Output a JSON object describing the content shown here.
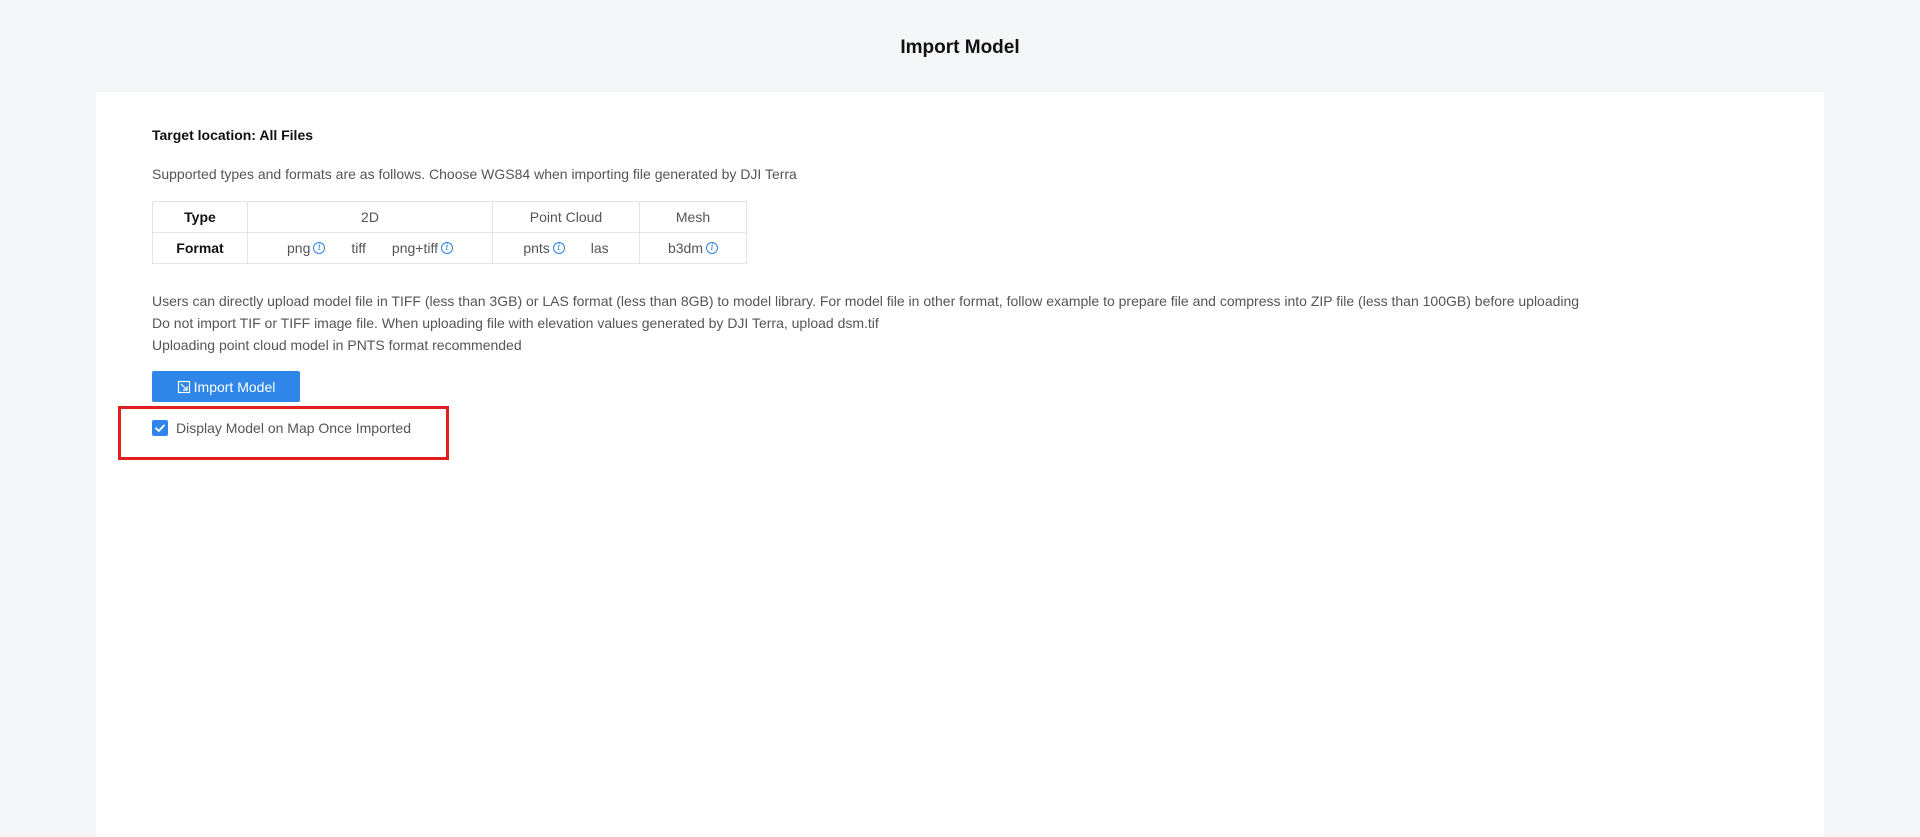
{
  "header": {
    "title": "Import Model"
  },
  "main": {
    "target_location": "Target location: All Files",
    "supported_text": "Supported types and formats are as follows. Choose WGS84 when importing file generated by DJI Terra",
    "table": {
      "type_label": "Type",
      "format_label": "Format",
      "types": [
        "2D",
        "Point Cloud",
        "Mesh"
      ],
      "formats_2d": [
        "png",
        "tiff",
        "png+tiff"
      ],
      "formats_pc": [
        "pnts",
        "las"
      ],
      "formats_mesh": [
        "b3dm"
      ]
    },
    "notes": [
      "Users can directly upload model file in TIFF (less than 3GB) or LAS format (less than 8GB) to model library. For model file in other format, follow example to prepare file and compress into ZIP file (less than 100GB) before uploading",
      "Do not import TIF or TIFF image file. When uploading file with elevation values generated by DJI Terra, upload dsm.tif",
      "Uploading point cloud model in PNTS format recommended"
    ],
    "import_button_label": "Import Model",
    "display_checkbox": {
      "label": "Display Model on Map Once Imported",
      "checked": true
    }
  },
  "icons": {
    "info": "info-icon",
    "import": "import-icon",
    "check": "check-icon"
  },
  "colors": {
    "accent": "#2e86e8",
    "highlight": "#e02020",
    "background": "#f5f6f8"
  }
}
